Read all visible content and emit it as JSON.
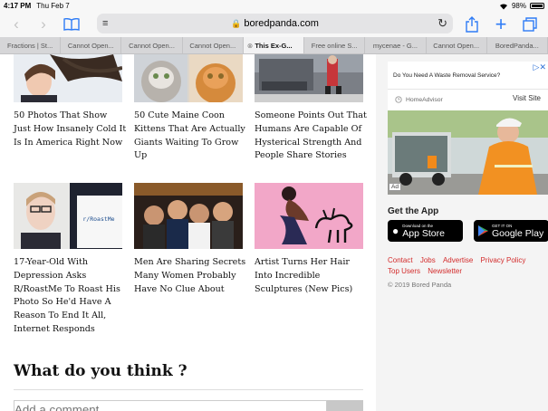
{
  "status": {
    "time": "4:17 PM",
    "date": "Thu Feb 7",
    "battery": "98%"
  },
  "browser": {
    "address": "boredpanda.com",
    "lock_glyph": "🔒"
  },
  "tabs": [
    "Fractions | St...",
    "Cannot Open...",
    "Cannot Open...",
    "Cannot Open...",
    "This Ex-G...",
    "Free online S...",
    "mycenae - G...",
    "Cannot Open...",
    "BoredPanda..."
  ],
  "articles": [
    {
      "title": "50 Photos That Show Just How Insanely Cold It Is In America Right Now"
    },
    {
      "title": "50 Cute Maine Coon Kittens That Are Actually Giants Waiting To Grow Up"
    },
    {
      "title": "Someone Points Out That Humans Are Capable Of Hysterical Strength And People Share Stories"
    },
    {
      "title": "17-Year-Old With Depression Asks R/RoastMe To Roast His Photo So He'd Have A Reason To End It All, Internet Responds",
      "sign_text": "r/RoastMe"
    },
    {
      "title": "Men Are Sharing Secrets Many Women Probably Have No Clue About"
    },
    {
      "title": "Artist Turns Her Hair Into Incredible Sculptures (New Pics)"
    }
  ],
  "comments": {
    "heading": "What do you think ?",
    "placeholder": "Add a comment..."
  },
  "ad": {
    "title": "Do You Need A Waste Removal Service?",
    "source": "HomeAdvisor",
    "cta": "Visit Site",
    "badge": "Ad"
  },
  "get_app": {
    "heading": "Get the App",
    "appstore_small": "Download on the",
    "appstore_large": "App Store",
    "googleplay_small": "GET IT ON",
    "googleplay_large": "Google Play"
  },
  "footer": {
    "links": [
      "Contact",
      "Jobs",
      "Advertise",
      "Privacy Policy",
      "Top Users",
      "Newsletter"
    ],
    "copyright": "© 2019 Bored Panda"
  },
  "colors": {
    "accent": "#2f7cf6",
    "link_red": "#d32b2b"
  }
}
